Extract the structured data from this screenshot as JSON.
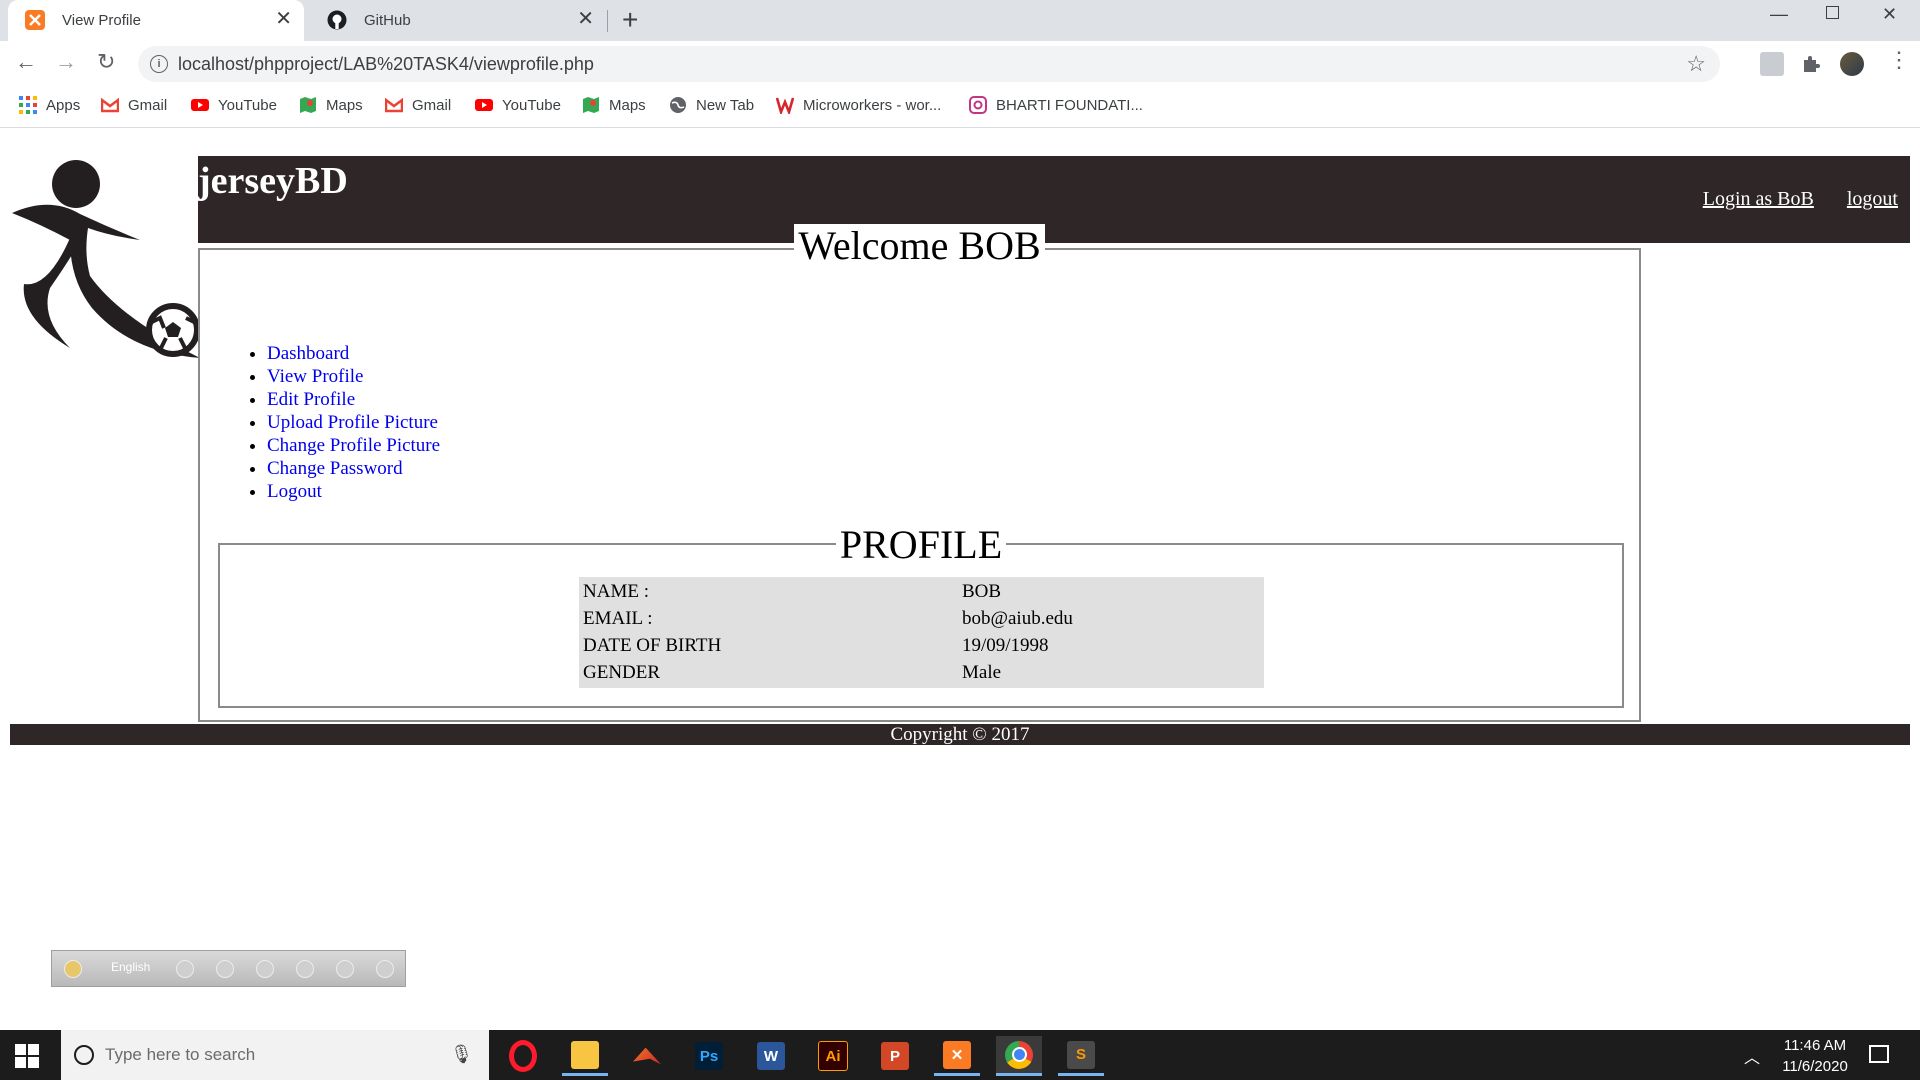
{
  "browser": {
    "tabs": [
      {
        "label": "View Profile",
        "active": true
      },
      {
        "label": "GitHub",
        "active": false
      }
    ],
    "url": "localhost/phpproject/LAB%20TASK4/viewprofile.php",
    "bookmarks": [
      {
        "label": "Apps",
        "icon": "apps-grid-icon"
      },
      {
        "label": "Gmail",
        "icon": "gmail-icon"
      },
      {
        "label": "YouTube",
        "icon": "youtube-icon"
      },
      {
        "label": "Maps",
        "icon": "maps-icon"
      },
      {
        "label": "Gmail",
        "icon": "gmail-icon"
      },
      {
        "label": "YouTube",
        "icon": "youtube-icon"
      },
      {
        "label": "Maps",
        "icon": "maps-icon"
      },
      {
        "label": "New Tab",
        "icon": "globe-icon"
      },
      {
        "label": "Microworkers - wor...",
        "icon": "microworkers-icon"
      },
      {
        "label": "BHARTI FOUNDATI...",
        "icon": "instagram-icon"
      }
    ]
  },
  "site": {
    "title": "jerseyBD",
    "login_link": "Login as BoB",
    "logout_link": "logout",
    "welcome": "Welcome BOB",
    "menu": [
      "Dashboard",
      "View Profile",
      "Edit Profile",
      "Upload Profile Picture",
      "Change Profile Picture",
      "Change Password",
      "Logout"
    ],
    "profile_heading": "PROFILE",
    "profile_rows": [
      {
        "label": "NAME :",
        "value": "BOB"
      },
      {
        "label": "EMAIL :",
        "value": "bob@aiub.edu"
      },
      {
        "label": "DATE OF BIRTH",
        "value": "19/09/1998"
      },
      {
        "label": "GENDER",
        "value": "Male"
      }
    ],
    "footer": "Copyright © 2017"
  },
  "language_bar": {
    "label": "English"
  },
  "taskbar": {
    "search_placeholder": "Type here to search",
    "time": "11:46 AM",
    "date": "11/6/2020"
  },
  "colors": {
    "header_bg": "#2e2627",
    "link": "#0000ee",
    "table_bg": "#e0e0e0"
  }
}
